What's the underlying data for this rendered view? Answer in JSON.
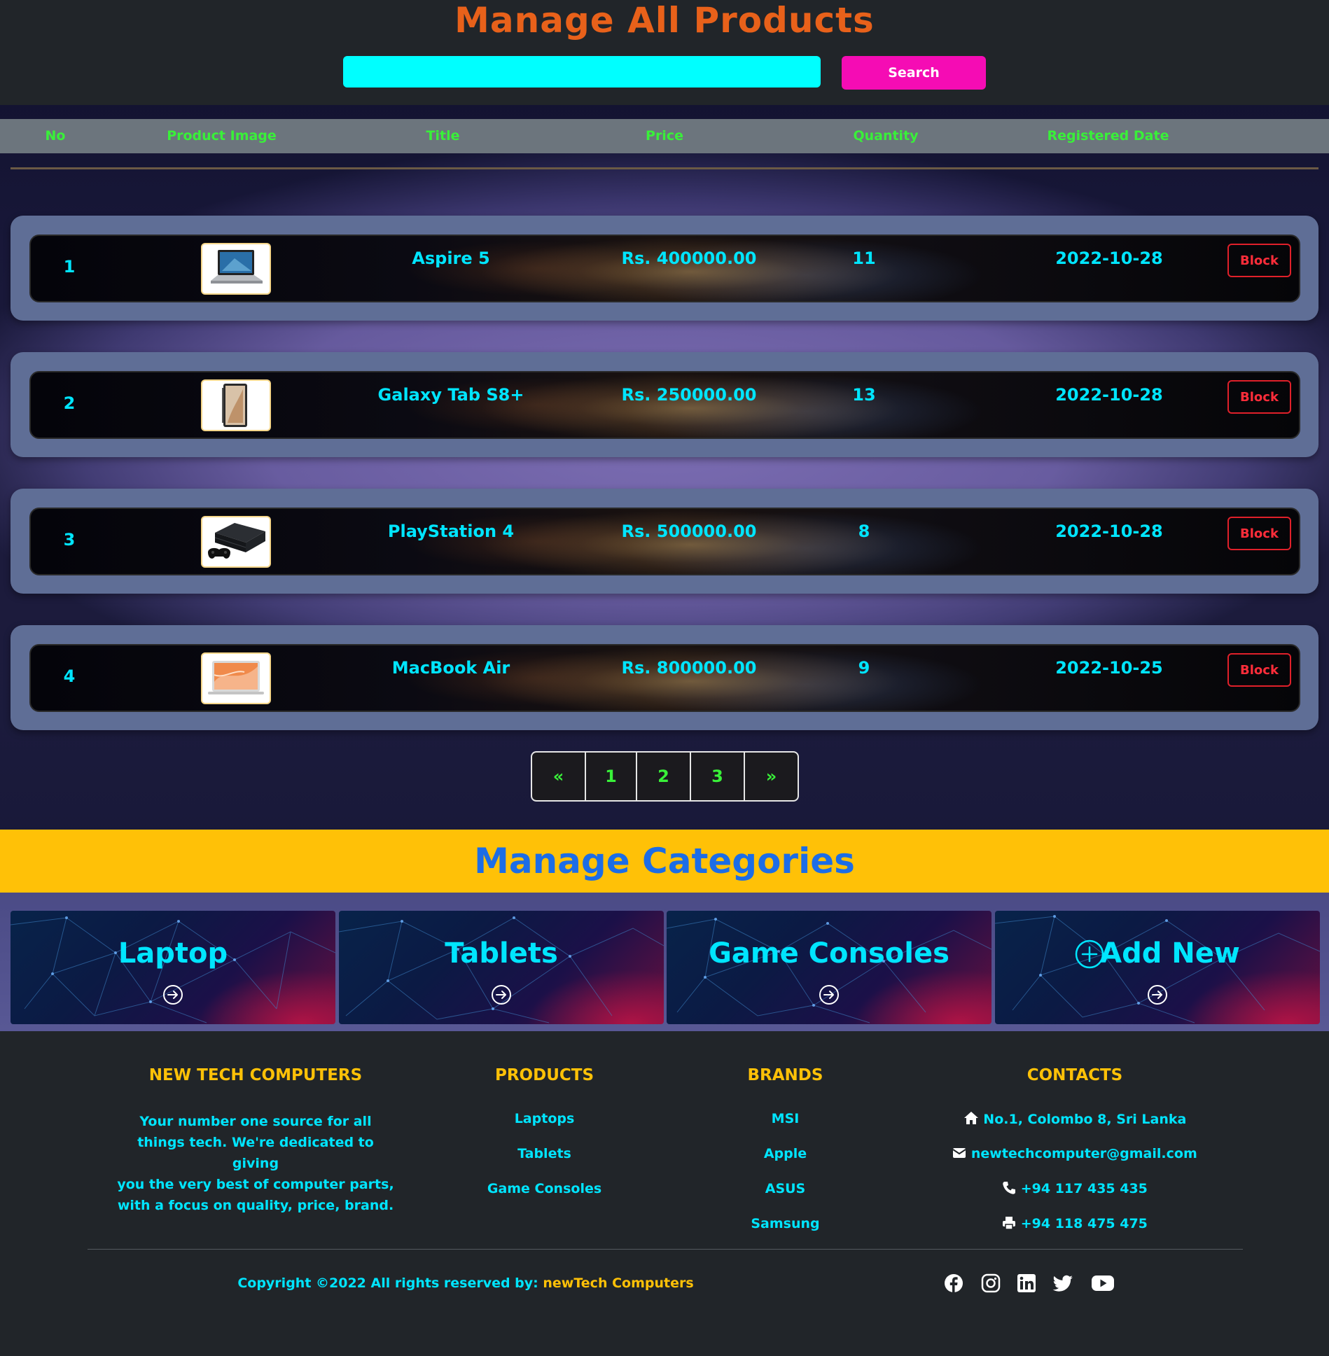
{
  "header": {
    "title": "Manage All Products",
    "search_placeholder": "",
    "search_value": "",
    "search_button": "Search"
  },
  "table": {
    "columns": [
      "No",
      "Product Image",
      "Title",
      "Price",
      "Quantity",
      "Registered Date"
    ],
    "rows": [
      {
        "no": "1",
        "title": "Aspire 5",
        "price": "Rs. 400000.00",
        "quantity": "11",
        "date": "2022-10-28",
        "action": "Block",
        "image_icon": "laptop-image"
      },
      {
        "no": "2",
        "title": "Galaxy Tab S8+",
        "price": "Rs. 250000.00",
        "quantity": "13",
        "date": "2022-10-28",
        "action": "Block",
        "image_icon": "tablet-image"
      },
      {
        "no": "3",
        "title": "PlayStation 4",
        "price": "Rs. 500000.00",
        "quantity": "8",
        "date": "2022-10-28",
        "action": "Block",
        "image_icon": "game-console-image"
      },
      {
        "no": "4",
        "title": "MacBook Air",
        "price": "Rs. 800000.00",
        "quantity": "9",
        "date": "2022-10-25",
        "action": "Block",
        "image_icon": "macbook-image"
      }
    ]
  },
  "pagination": {
    "prev": "«",
    "pages": [
      "1",
      "2",
      "3"
    ],
    "next": "»"
  },
  "categories": {
    "title": "Manage Categories",
    "items": [
      {
        "label": "Laptop"
      },
      {
        "label": "Tablets"
      },
      {
        "label": "Game Consoles"
      },
      {
        "label": "Add New",
        "icon": "plus-circle-icon"
      }
    ]
  },
  "footer": {
    "company": {
      "heading": "NEW TECH COMPUTERS",
      "lines": [
        "Your number one source for all",
        "things tech. We're dedicated to giving",
        "you the very best of computer parts,",
        "with a focus on quality, price, brand."
      ]
    },
    "products": {
      "heading": "PRODUCTS",
      "items": [
        "Laptops",
        "Tablets",
        "Game Consoles"
      ]
    },
    "brands": {
      "heading": "BRANDS",
      "items": [
        "MSI",
        "Apple",
        "ASUS",
        "Samsung"
      ]
    },
    "contacts": {
      "heading": "CONTACTS",
      "address": "No.1, Colombo 8, Sri Lanka",
      "email": "newtechcomputer@gmail.com",
      "phone": "+94 117 435 435",
      "fax": "+94 118 475 475"
    },
    "copyright_prefix": "Copyright ©2022 All rights reserved by: ",
    "copyright_brand": "newTech Computers",
    "social": [
      "facebook-icon",
      "instagram-icon",
      "linkedin-icon",
      "twitter-icon",
      "youtube-icon"
    ]
  },
  "colors": {
    "title": "#e8611a",
    "search_bg": "#00ffff",
    "search_button": "#f50cb4",
    "table_header_bg": "#6c757d",
    "table_header_text": "#39f039",
    "cell_text": "#00e5ff",
    "block": "#ff2d3a",
    "banner": "#ffc107",
    "banner_text": "#1c6de6",
    "footer_heading": "#ffc107"
  }
}
